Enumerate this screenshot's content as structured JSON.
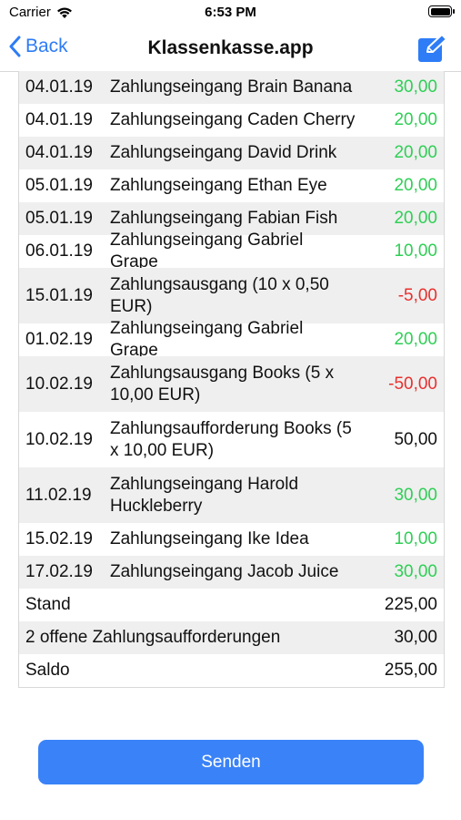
{
  "status": {
    "carrier": "Carrier",
    "time": "6:53 PM"
  },
  "nav": {
    "back_label": "Back",
    "title": "Klassenkasse.app"
  },
  "transactions": [
    {
      "date": "04.01.19",
      "desc": "Zahlungseingang Brain Banana",
      "amount": "30,00",
      "type": "pos"
    },
    {
      "date": "04.01.19",
      "desc": "Zahlungseingang Caden Cherry",
      "amount": "20,00",
      "type": "pos"
    },
    {
      "date": "04.01.19",
      "desc": "Zahlungseingang David Drink",
      "amount": "20,00",
      "type": "pos"
    },
    {
      "date": "05.01.19",
      "desc": "Zahlungseingang Ethan Eye",
      "amount": "20,00",
      "type": "pos"
    },
    {
      "date": "05.01.19",
      "desc": "Zahlungseingang Fabian Fish",
      "amount": "20,00",
      "type": "pos"
    },
    {
      "date": "06.01.19",
      "desc": "Zahlungseingang Gabriel Grape",
      "amount": "10,00",
      "type": "pos"
    },
    {
      "date": "15.01.19",
      "desc": "Zahlungsausgang (10 x 0,50 EUR)",
      "amount": "-5,00",
      "type": "neg"
    },
    {
      "date": "01.02.19",
      "desc": "Zahlungseingang Gabriel Grape",
      "amount": "20,00",
      "type": "pos"
    },
    {
      "date": "10.02.19",
      "desc": "Zahlungsausgang Books (5 x 10,00 EUR)",
      "amount": "-50,00",
      "type": "neg"
    },
    {
      "date": "10.02.19",
      "desc": "Zahlungsaufforderung Books (5 x 10,00 EUR)",
      "amount": "50,00",
      "type": "neutral"
    },
    {
      "date": "11.02.19",
      "desc": "Zahlungseingang Harold Huckleberry",
      "amount": "30,00",
      "type": "pos"
    },
    {
      "date": "15.02.19",
      "desc": "Zahlungseingang Ike Idea",
      "amount": "10,00",
      "type": "pos"
    },
    {
      "date": "17.02.19",
      "desc": "Zahlungseingang Jacob Juice",
      "amount": "30,00",
      "type": "pos"
    }
  ],
  "summary": {
    "stand_label": "Stand",
    "stand_value": "225,00",
    "open_label": "2 offene Zahlungsaufforderungen",
    "open_value": "30,00",
    "saldo_label": "Saldo",
    "saldo_value": "255,00"
  },
  "send_label": "Senden",
  "colors": {
    "accent": "#2e7cf6",
    "positive": "#2fcf55",
    "negative": "#e8302e",
    "button": "#3a82f7"
  }
}
